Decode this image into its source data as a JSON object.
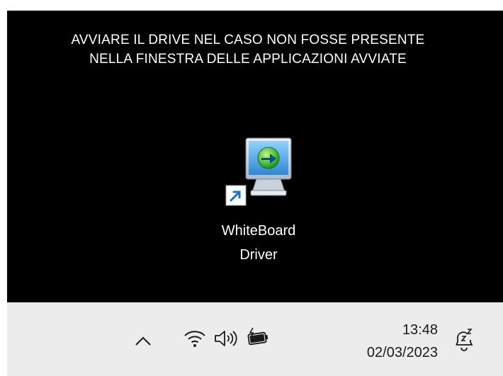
{
  "banner": {
    "line1": "AVVIARE IL DRIVE NEL CASO NON FOSSE PRESENTE",
    "line2": "NELLA FINESTRA DELLE APPLICAZIONI AVVIATE"
  },
  "desktop_icon": {
    "label_line1": "WhiteBoard",
    "label_line2": "Driver",
    "icon": "monitor-arrow-icon",
    "overlay_icon": "shortcut-arrow-icon"
  },
  "taskbar": {
    "tray_icons": [
      "chevron-up-icon",
      "wifi-icon",
      "speaker-icon",
      "battery-charging-icon"
    ],
    "time": "13:48",
    "date": "02/03/2023",
    "notification_icon": "notification-sleep-icon"
  },
  "colors": {
    "desktop_bg": "#000000",
    "taskbar_bg": "#ececec",
    "text_light": "#ffffff",
    "text_dark": "#1a1a1a"
  }
}
